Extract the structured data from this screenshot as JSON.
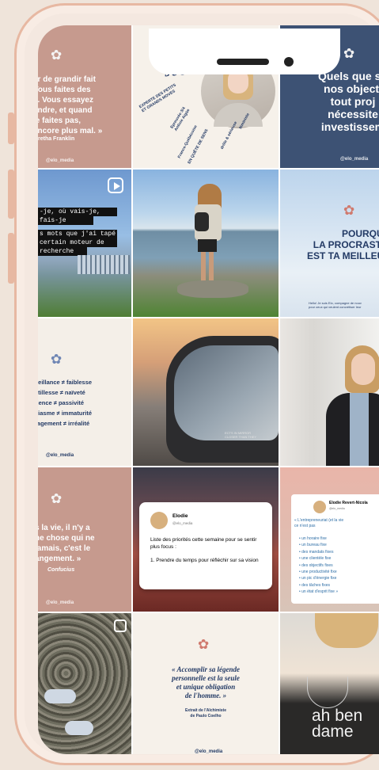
{
  "profile_handle": "@elo_media",
  "posts": {
    "p1": {
      "quote": "er de grandir fait\nVous faites des\ns. Vous essayez\nendre, et quand\nle faites pas,\nencore plus mal. »",
      "author": "retha Franklin",
      "handle": "@elo_media"
    },
    "p2": {
      "title": "Je suis Elo",
      "tag1": "EXPERTE DES PETITS\nET GRANDS MOVES",
      "tag2": "Epreuvée 3/4\nAntivie Aigüe",
      "tag3": "France-Québécoise",
      "tag4": "EN QUÊTE DE SENS",
      "tag5": "drôle & sérieuse",
      "tag6": "féministe"
    },
    "p3": {
      "text": "Quels que so\nnos objecti\ntout proj\nnécessite\ninvestissem",
      "handle": "@elo_media"
    },
    "p4": {
      "lines": [
        "-je, où vais-je,",
        "fais-je",
        "s mots que j'ai tapé",
        "certain moteur de",
        "recherche"
      ]
    },
    "p6": {
      "text": "POURQUO\nLA PROCRASTIN\nEST TA MEILLEUR",
      "foot": "Hello! Je suis Elo, compagne de nouv\npour ceux qui veulent concrétiser leur"
    },
    "p7": {
      "lines": [
        "veillance ≠ faiblesse",
        "stillesse ≠ naïveté",
        "tience ≠ passivité",
        "siasme ≠ immaturité",
        "ragement ≠ irréalité"
      ],
      "handle": "@elo_media"
    },
    "p8": {
      "mirror": "ECTS IN MIRROR\nCLOSER THAN THEY"
    },
    "p10": {
      "quote": "s la vie, il n'y a\nne chose qui ne\njamais, c'est le\nangement. »",
      "author": "Confucius",
      "handle": "@elo_media"
    },
    "p11": {
      "name": "Elodie",
      "handle": "@elo_media",
      "text": "Liste des priorités cette semaine pour se sentir plus focus :",
      "item": "1. Prendre du temps pour réfléchir sur sa vision"
    },
    "p12": {
      "name": "Elodie Revert-Nicola",
      "handle": "@elo_media",
      "intro": "« L'entrepreneuriat (et la vie\nce n'est pas",
      "items": [
        "un horaire fixe",
        "un bureau fixe",
        "des mandats fixes",
        "une clientèle fixe",
        "des objectifs fixes",
        "une productivité fixe",
        "un pic d'énergie fixe",
        "des tâches fixes",
        "un état d'esprit fixe »"
      ]
    },
    "p14": {
      "quote": "« Accomplir sa légende\npersonnelle est la seule\net unique obligation\nde l'homme. »",
      "src": "Extrait de l'Alchimiste\nde Paulo Coelho",
      "handle": "@elo_media"
    },
    "p15": {
      "shirt": "ah ben\ndame"
    }
  }
}
